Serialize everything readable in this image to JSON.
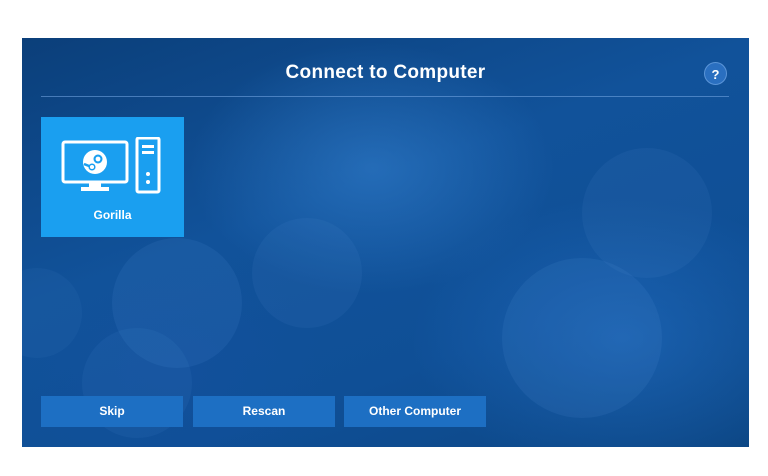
{
  "header": {
    "title": "Connect to Computer",
    "help_label": "?"
  },
  "computers": [
    {
      "name": "Gorilla",
      "icon": "steam-desktop-icon"
    }
  ],
  "footer": {
    "skip_label": "Skip",
    "rescan_label": "Rescan",
    "other_label": "Other Computer"
  },
  "colors": {
    "background": "#11529a",
    "tile": "#1a9ff0",
    "button": "#1d6fc3",
    "text": "#ffffff"
  }
}
